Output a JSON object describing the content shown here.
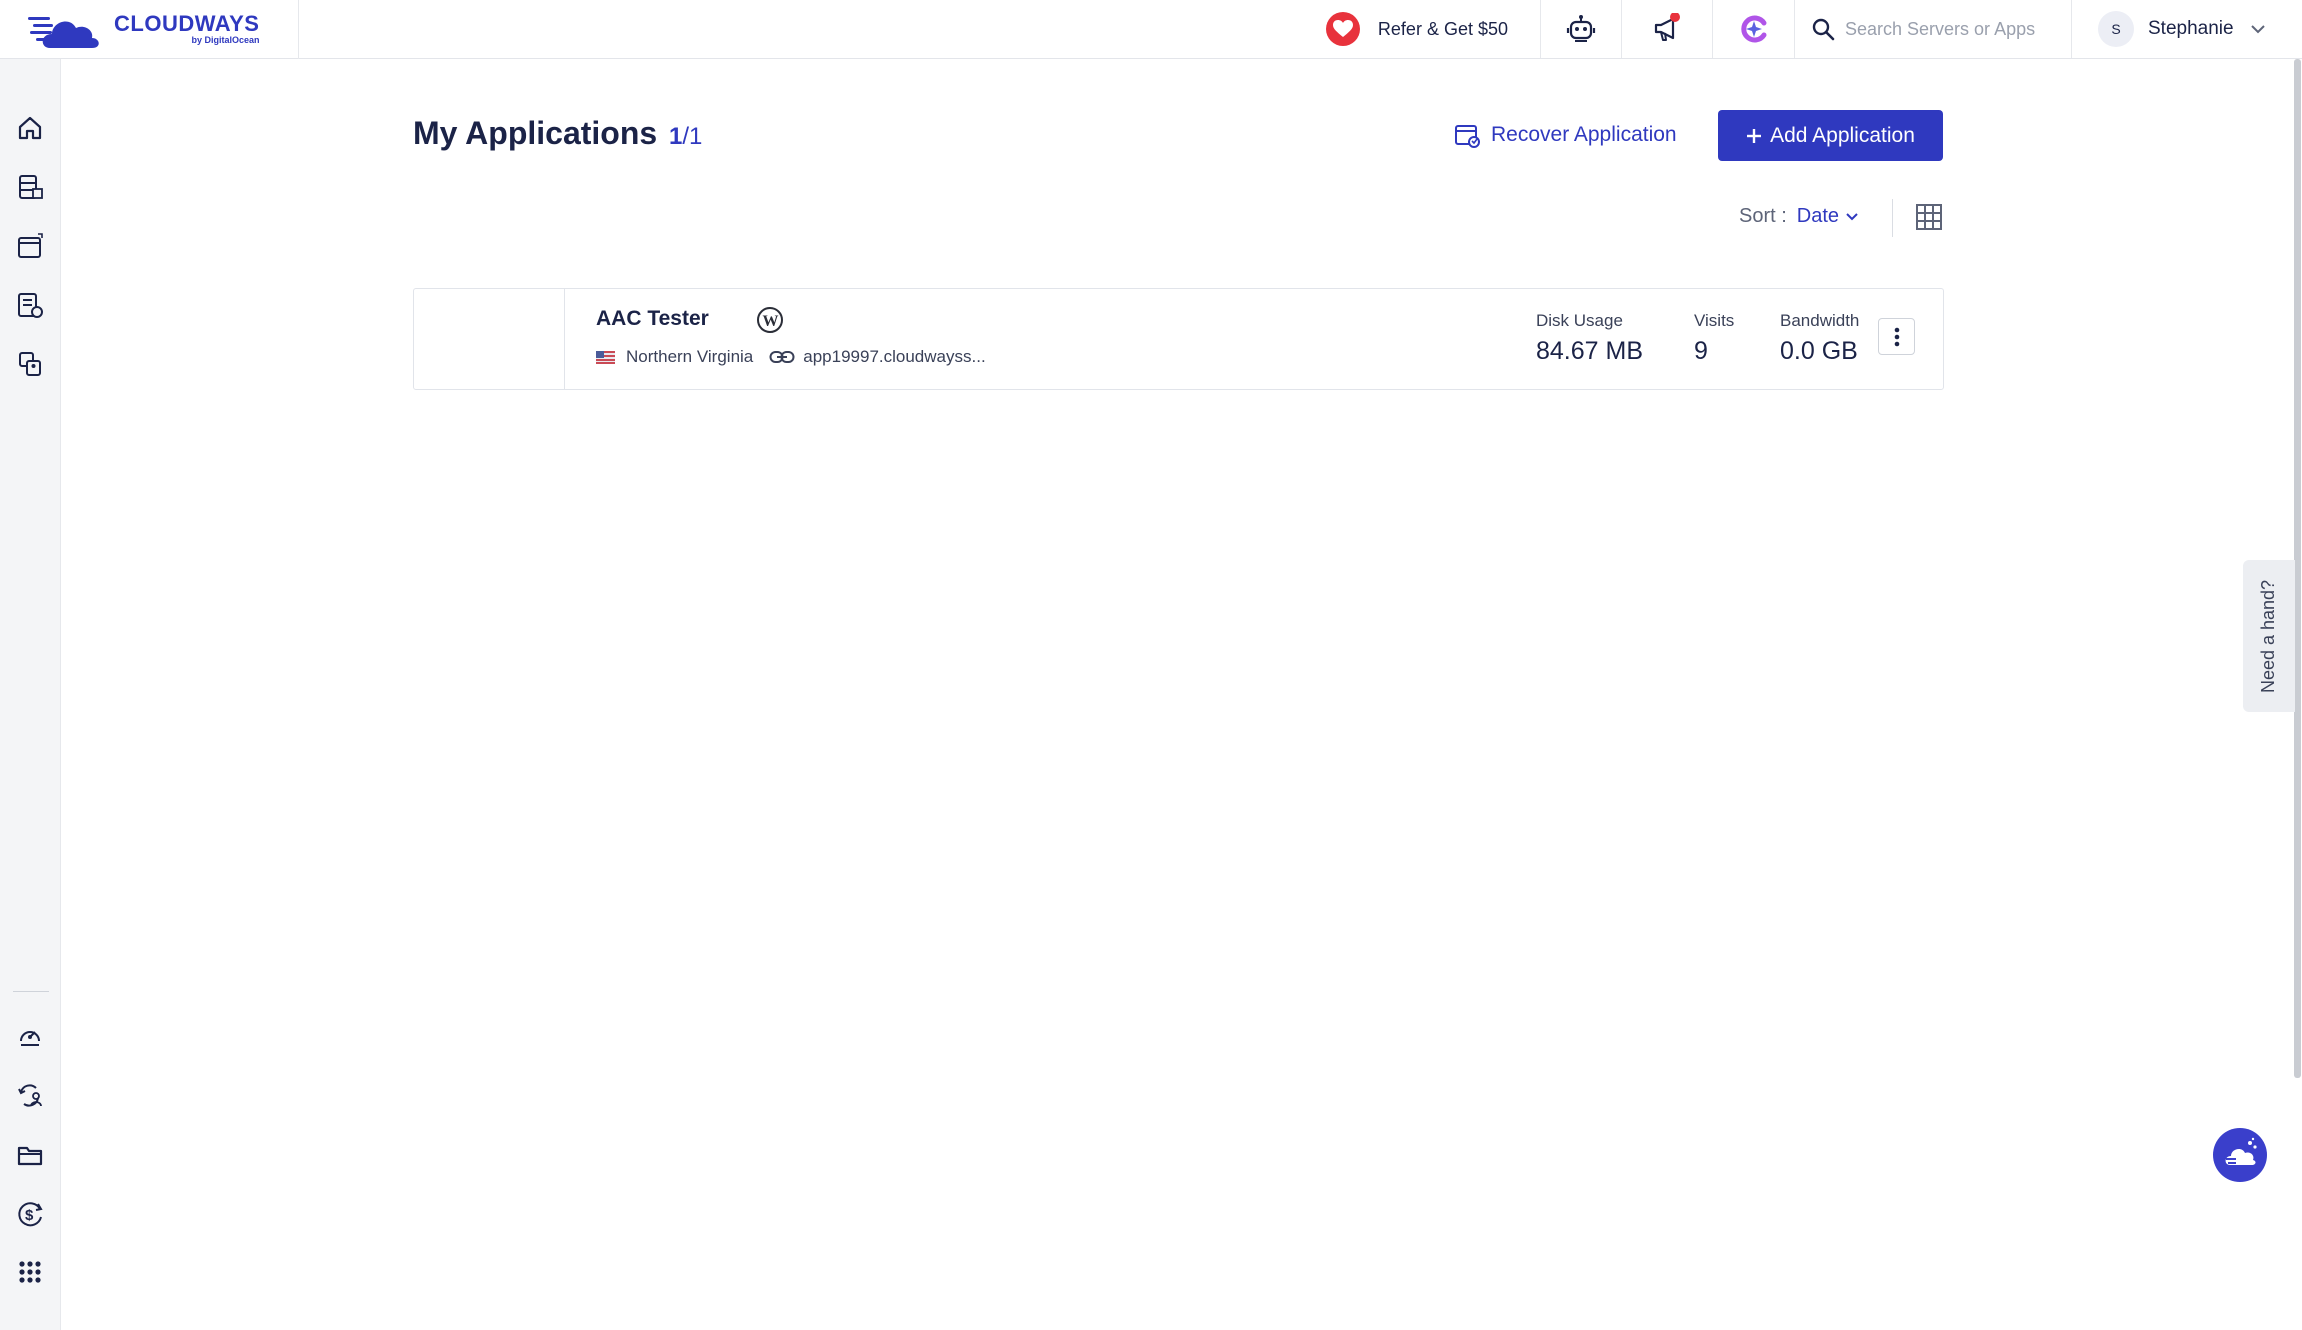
{
  "brand": {
    "name": "CLOUDWAYS",
    "sub": "by DigitalOcean",
    "accent": "#2f39bf"
  },
  "topbar": {
    "refer_label": "Refer & Get $50",
    "icons": [
      "heart-icon",
      "robot-icon",
      "megaphone-icon",
      "copilot-icon",
      "search-icon"
    ],
    "search_placeholder": "Search Servers or Apps",
    "user": {
      "initial": "S",
      "name": "Stephanie"
    }
  },
  "sidebar": {
    "items": [
      "home-icon",
      "servers-icon",
      "applications-icon",
      "activity-log-icon",
      "teams-icon"
    ],
    "bottom_items": [
      "support-icon",
      "migration-icon",
      "folder-icon",
      "billing-icon",
      "apps-grid-icon"
    ]
  },
  "page": {
    "title": "My Applications",
    "count_current": "1",
    "count_total": "/1",
    "recover_label": "Recover Application",
    "add_label": "Add Application",
    "sort_label": "Sort :",
    "sort_value": "Date"
  },
  "applications": [
    {
      "name": "AAC Tester",
      "platform": "wordpress-icon",
      "location": "Northern Virginia",
      "url": "app19997.cloudwayss...",
      "disk_label": "Disk Usage",
      "disk_value": "84.67 MB",
      "visits_label": "Visits",
      "visits_value": "9",
      "bandwidth_label": "Bandwidth",
      "bandwidth_value": "0.0 GB"
    }
  ],
  "help": {
    "need_hand_label": "Need a hand?"
  }
}
